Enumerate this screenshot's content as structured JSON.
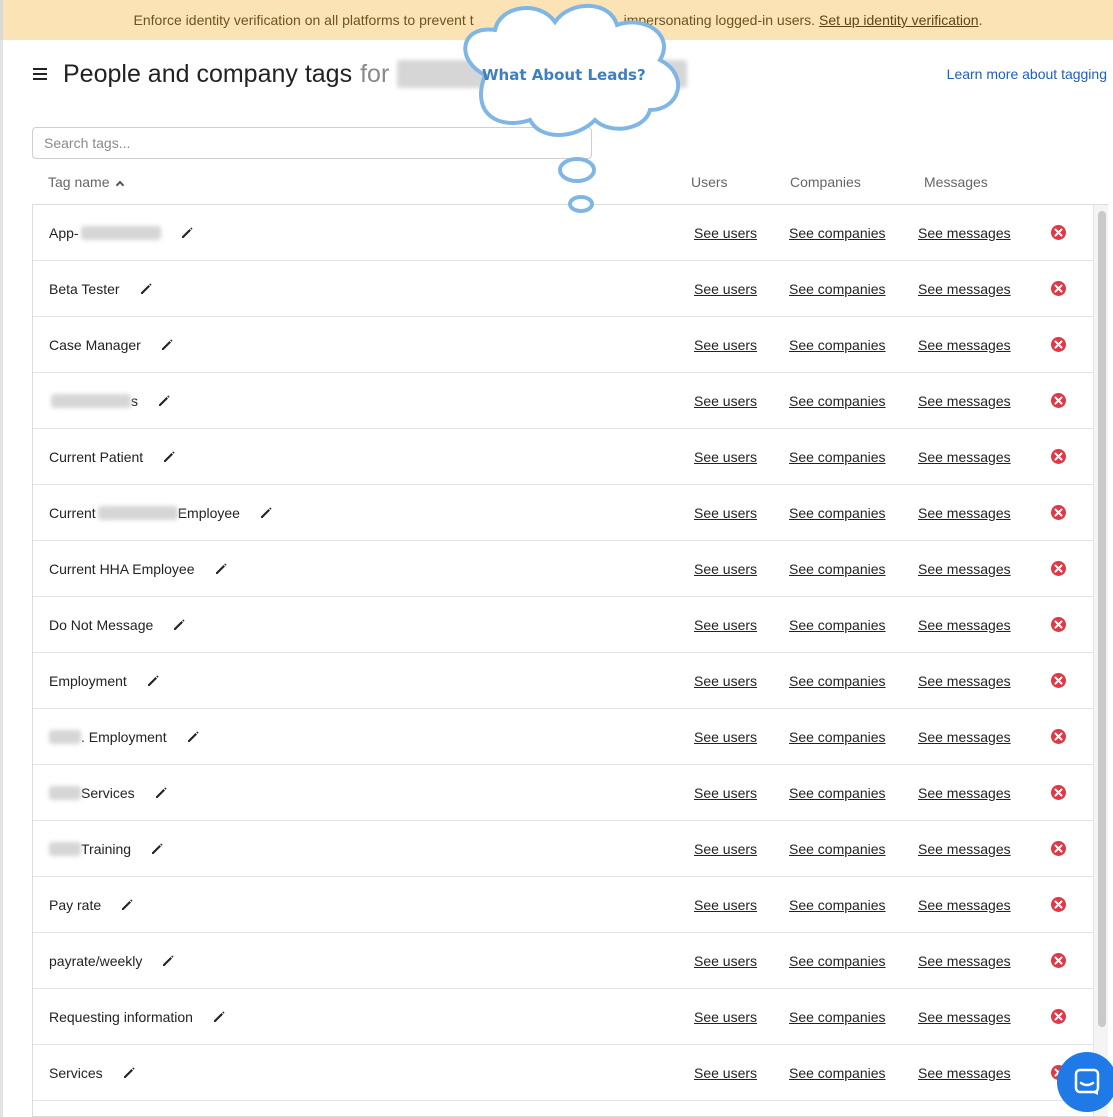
{
  "banner": {
    "text_before": "Enforce identity verification on all platforms to prevent t",
    "text_middle": "impersonating logged-in users.",
    "link": "Set up identity verification",
    "text_after": "."
  },
  "header": {
    "title": "People and company tags",
    "for_label": "for",
    "learn_more": "Learn more about tagging"
  },
  "search": {
    "placeholder": "Search tags..."
  },
  "columns": {
    "tag_name": "Tag name",
    "users": "Users",
    "companies": "Companies",
    "messages": "Messages"
  },
  "row_links": {
    "users": "See users",
    "companies": "See companies",
    "messages": "See messages"
  },
  "rows": [
    {
      "pre": "App- ",
      "blur": "long",
      "post": ""
    },
    {
      "pre": "Beta Tester",
      "blur": "",
      "post": ""
    },
    {
      "pre": "Case Manager",
      "blur": "",
      "post": ""
    },
    {
      "pre": "",
      "blur": "long",
      "post": "s"
    },
    {
      "pre": "Current Patient",
      "blur": "",
      "post": ""
    },
    {
      "pre": "Current ",
      "blur": "long",
      "post": " Employee"
    },
    {
      "pre": "Current HHA Employee",
      "blur": "",
      "post": ""
    },
    {
      "pre": "Do Not Message",
      "blur": "",
      "post": ""
    },
    {
      "pre": "Employment",
      "blur": "",
      "post": ""
    },
    {
      "pre": "",
      "blur": "short",
      "post": ". Employment"
    },
    {
      "pre": "",
      "blur": "short",
      "post": " Services"
    },
    {
      "pre": "",
      "blur": "short",
      "post": " Training"
    },
    {
      "pre": "Pay rate",
      "blur": "",
      "post": ""
    },
    {
      "pre": "payrate/weekly",
      "blur": "",
      "post": ""
    },
    {
      "pre": "Requesting information",
      "blur": "",
      "post": ""
    },
    {
      "pre": "Services",
      "blur": "",
      "post": ""
    }
  ],
  "annotation": {
    "text": "What About Leads?"
  },
  "icons": {
    "menu": "hamburger-icon",
    "sort": "chevron-up-icon",
    "edit": "pencil-icon",
    "delete": "delete-circle-icon",
    "chat": "messenger-icon"
  },
  "colors": {
    "banner_bg": "#fbe3b5",
    "link_blue": "#1f5fbf",
    "delete_red": "#dd3947",
    "messenger_blue": "#1f7ae8",
    "cloud_text": "#3d7fc0"
  }
}
